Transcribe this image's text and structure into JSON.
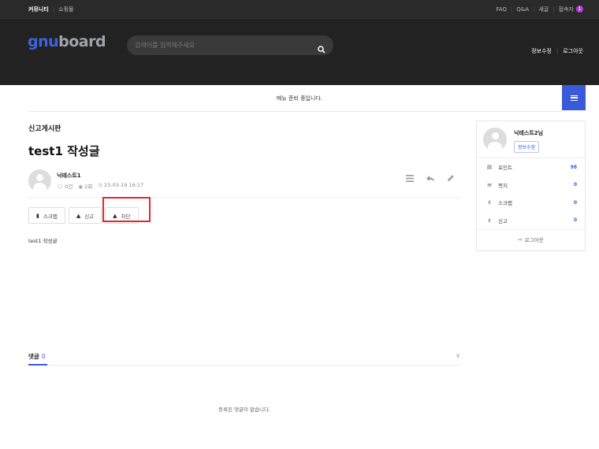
{
  "topbar": {
    "left": [
      "커뮤니티",
      "쇼핑몰"
    ],
    "right": [
      "FAQ",
      "Q&A",
      "새글",
      "접속자"
    ],
    "visitor_count": "1"
  },
  "header": {
    "logo_prefix": "gnu",
    "logo_suffix": "board",
    "search_placeholder": "검색어를 입력해주세요",
    "user_menu": [
      "정보수정",
      "로그아웃"
    ]
  },
  "menubar": {
    "notice": "메뉴 준비 중입니다."
  },
  "post": {
    "board_name": "신고게시판",
    "title": "test1 작성글",
    "writer": "닉테스트1",
    "comments": "0건",
    "views": "2회",
    "date": "23-03-19 16:17",
    "buttons": [
      "스크랩",
      "신고",
      "차단"
    ],
    "content": "test1 작성글"
  },
  "comments": {
    "label": "댓글",
    "count": "0",
    "empty_text": "등록된 댓글이 없습니다."
  },
  "sidebar": {
    "nickname": "닉테스트2님",
    "edit_label": "정보수정",
    "items": [
      {
        "label": "포인트",
        "value": "98",
        "icon": "point-icon"
      },
      {
        "label": "쪽지",
        "value": "0",
        "icon": "envelope-icon"
      },
      {
        "label": "스크랩",
        "value": "0",
        "icon": "pin-icon"
      },
      {
        "label": "신고",
        "value": "0",
        "icon": "pin-icon"
      }
    ],
    "logout_label": "로그아웃"
  },
  "colors": {
    "accent": "#3a5bd9",
    "highlight": "#e0282e",
    "topbar_bg": "#2a2a2a",
    "header_bg": "#222222"
  }
}
